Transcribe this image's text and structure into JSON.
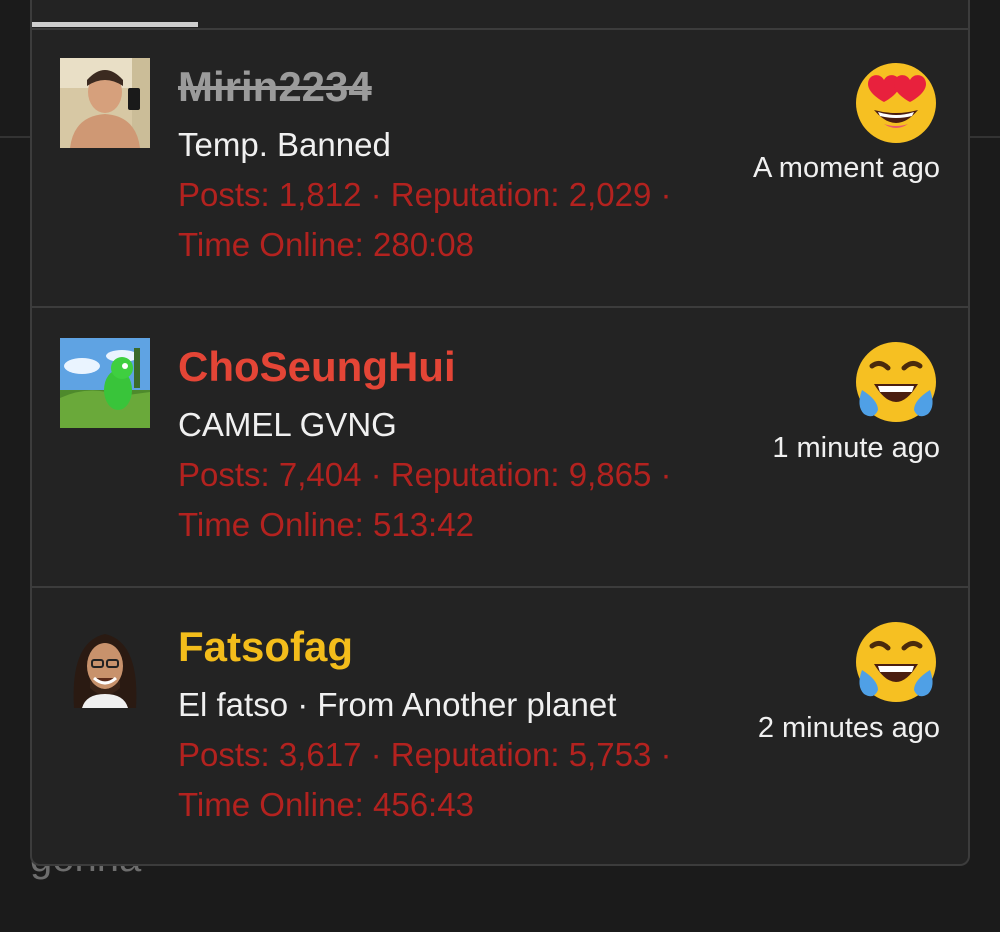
{
  "background": {
    "partial_text": "gonna"
  },
  "reactions": [
    {
      "username": "Mirin2234",
      "username_color": "#9b9b9b",
      "strikethrough": true,
      "user_title": "Temp. Banned",
      "stats_line1": "Posts: 1,812 · Reputation: 2,029 ·",
      "stats_line2": "Time Online: 280:08",
      "reaction_icon": "heart-eyes-emoji-icon",
      "time": "A moment ago"
    },
    {
      "username": "ChoSeungHui",
      "username_color": "#e44536",
      "strikethrough": false,
      "user_title": "CAMEL GVNG",
      "stats_line1": "Posts: 7,404 · Reputation: 9,865 ·",
      "stats_line2": "Time Online: 513:42",
      "reaction_icon": "tears-of-joy-emoji-icon",
      "time": "1 minute ago"
    },
    {
      "username": "Fatsofag",
      "username_color": "#f3bd1b",
      "strikethrough": false,
      "user_title": "El fatso · From Another planet",
      "stats_line1": "Posts: 3,617 · Reputation: 5,753 ·",
      "stats_line2": "Time Online: 456:43",
      "reaction_icon": "tears-of-joy-emoji-icon",
      "time": "2 minutes ago"
    }
  ]
}
